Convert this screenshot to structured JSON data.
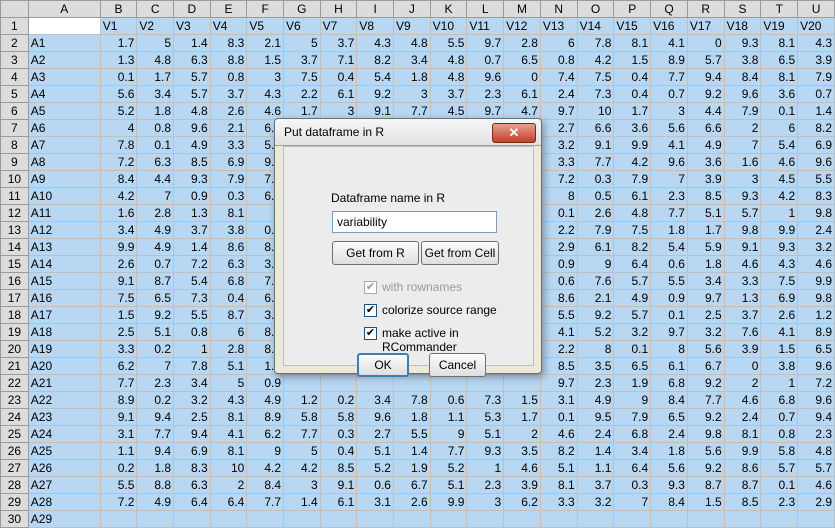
{
  "spreadsheet": {
    "columns": [
      "A",
      "B",
      "C",
      "D",
      "E",
      "F",
      "G",
      "H",
      "I",
      "J",
      "K",
      "L",
      "M",
      "N",
      "O",
      "P",
      "Q",
      "R",
      "S",
      "T",
      "U"
    ],
    "header_row": [
      "",
      "V1",
      "V2",
      "V3",
      "V4",
      "V5",
      "V6",
      "V7",
      "V8",
      "V9",
      "V10",
      "V11",
      "V12",
      "V13",
      "V14",
      "V15",
      "V16",
      "V17",
      "V18",
      "V19",
      "V20"
    ],
    "rows": [
      {
        "n": "2",
        "c": [
          "A1",
          "1.7",
          "5",
          "1.4",
          "8.3",
          "2.1",
          "5",
          "3.7",
          "4.3",
          "4.8",
          "5.5",
          "9.7",
          "2.8",
          "6",
          "7.8",
          "8.1",
          "4.1",
          "0",
          "9.3",
          "8.1",
          "4.3"
        ]
      },
      {
        "n": "3",
        "c": [
          "A2",
          "1.3",
          "4.8",
          "6.3",
          "8.8",
          "1.5",
          "3.7",
          "7.1",
          "8.2",
          "3.4",
          "4.8",
          "0.7",
          "6.5",
          "0.8",
          "4.2",
          "1.5",
          "8.9",
          "5.7",
          "3.8",
          "6.5",
          "3.9"
        ]
      },
      {
        "n": "4",
        "c": [
          "A3",
          "0.1",
          "1.7",
          "5.7",
          "0.8",
          "3",
          "7.5",
          "0.4",
          "5.4",
          "1.8",
          "4.8",
          "9.6",
          "0",
          "7.4",
          "7.5",
          "0.4",
          "7.7",
          "9.4",
          "8.4",
          "8.1",
          "7.9"
        ]
      },
      {
        "n": "5",
        "c": [
          "A4",
          "5.6",
          "3.4",
          "5.7",
          "3.7",
          "4.3",
          "2.2",
          "6.1",
          "9.2",
          "3",
          "3.7",
          "2.3",
          "6.1",
          "2.4",
          "7.3",
          "0.4",
          "0.7",
          "9.2",
          "9.6",
          "3.6",
          "0.7"
        ]
      },
      {
        "n": "6",
        "c": [
          "A5",
          "5.2",
          "1.8",
          "4.8",
          "2.6",
          "4.6",
          "1.7",
          "3",
          "9.1",
          "7.7",
          "4.5",
          "9.7",
          "4.7",
          "9.7",
          "10",
          "1.7",
          "3",
          "4.4",
          "7.9",
          "0.1",
          "1.4"
        ]
      },
      {
        "n": "7",
        "c": [
          "A6",
          "4",
          "0.8",
          "9.6",
          "2.1",
          "6.7",
          "",
          "",
          "",
          "",
          "",
          "",
          "",
          "2.7",
          "6.6",
          "3.6",
          "5.6",
          "6.6",
          "2",
          "6",
          "8.2"
        ]
      },
      {
        "n": "8",
        "c": [
          "A7",
          "7.8",
          "0.1",
          "4.9",
          "3.3",
          "5.9",
          "",
          "",
          "",
          "",
          "",
          "",
          "",
          "3.2",
          "9.1",
          "9.9",
          "4.1",
          "4.9",
          "7",
          "5.4",
          "6.9"
        ]
      },
      {
        "n": "9",
        "c": [
          "A8",
          "7.2",
          "6.3",
          "8.5",
          "6.9",
          "9.5",
          "",
          "",
          "",
          "",
          "",
          "",
          "",
          "3.3",
          "7.7",
          "4.2",
          "9.6",
          "3.6",
          "1.6",
          "4.6",
          "9.6"
        ]
      },
      {
        "n": "10",
        "c": [
          "A9",
          "8.4",
          "4.4",
          "9.3",
          "7.9",
          "7.8",
          "",
          "",
          "",
          "",
          "",
          "",
          "",
          "7.2",
          "0.3",
          "7.9",
          "7",
          "3.9",
          "3",
          "4.5",
          "5.5"
        ]
      },
      {
        "n": "11",
        "c": [
          "A10",
          "4.2",
          "7",
          "0.9",
          "0.3",
          "6.7",
          "",
          "",
          "",
          "",
          "",
          "",
          "",
          "8",
          "0.5",
          "6.1",
          "2.3",
          "8.5",
          "9.3",
          "4.2",
          "8.3"
        ]
      },
      {
        "n": "12",
        "c": [
          "A11",
          "1.6",
          "2.8",
          "1.3",
          "8.1",
          "5",
          "",
          "",
          "",
          "",
          "",
          "",
          "",
          "0.1",
          "2.6",
          "4.8",
          "7.7",
          "5.1",
          "5.7",
          "1",
          "9.8"
        ]
      },
      {
        "n": "13",
        "c": [
          "A12",
          "3.4",
          "4.9",
          "3.7",
          "3.8",
          "0.2",
          "",
          "",
          "",
          "",
          "",
          "",
          "",
          "2.2",
          "7.9",
          "7.5",
          "1.8",
          "1.7",
          "9.8",
          "9.9",
          "2.4"
        ]
      },
      {
        "n": "14",
        "c": [
          "A13",
          "9.9",
          "4.9",
          "1.4",
          "8.6",
          "8.3",
          "",
          "",
          "",
          "",
          "",
          "",
          "",
          "2.9",
          "6.1",
          "8.2",
          "5.4",
          "5.9",
          "9.1",
          "9.3",
          "3.2"
        ]
      },
      {
        "n": "15",
        "c": [
          "A14",
          "2.6",
          "0.7",
          "7.2",
          "6.3",
          "3.8",
          "",
          "",
          "",
          "",
          "",
          "",
          "",
          "0.9",
          "9",
          "6.4",
          "0.6",
          "1.8",
          "4.6",
          "4.3",
          "4.6"
        ]
      },
      {
        "n": "16",
        "c": [
          "A15",
          "9.1",
          "8.7",
          "5.4",
          "6.8",
          "7.6",
          "",
          "",
          "",
          "",
          "",
          "",
          "",
          "0.6",
          "7.6",
          "5.7",
          "5.5",
          "3.4",
          "3.3",
          "7.5",
          "9.9"
        ]
      },
      {
        "n": "17",
        "c": [
          "A16",
          "7.5",
          "6.5",
          "7.3",
          "0.4",
          "6.8",
          "",
          "",
          "",
          "",
          "",
          "",
          "",
          "8.6",
          "2.1",
          "4.9",
          "0.9",
          "9.7",
          "1.3",
          "6.9",
          "9.8"
        ]
      },
      {
        "n": "18",
        "c": [
          "A17",
          "1.5",
          "9.2",
          "5.5",
          "8.7",
          "3.3",
          "",
          "",
          "",
          "",
          "",
          "",
          "",
          "5.5",
          "9.2",
          "5.7",
          "0.1",
          "2.5",
          "3.7",
          "2.6",
          "1.2"
        ]
      },
      {
        "n": "19",
        "c": [
          "A18",
          "2.5",
          "5.1",
          "0.8",
          "6",
          "8.6",
          "",
          "",
          "",
          "",
          "",
          "",
          "",
          "4.1",
          "5.2",
          "3.2",
          "9.7",
          "3.2",
          "7.6",
          "4.1",
          "8.9"
        ]
      },
      {
        "n": "20",
        "c": [
          "A19",
          "3.3",
          "0.2",
          "1",
          "2.8",
          "8.6",
          "",
          "",
          "",
          "",
          "",
          "",
          "",
          "2.2",
          "8",
          "0.1",
          "8",
          "5.6",
          "3.9",
          "1.5",
          "6.5"
        ]
      },
      {
        "n": "21",
        "c": [
          "A20",
          "6.2",
          "7",
          "7.8",
          "5.1",
          "1.1",
          "",
          "",
          "",
          "",
          "",
          "",
          "",
          "8.5",
          "3.5",
          "6.5",
          "6.1",
          "6.7",
          "0",
          "3.8",
          "9.6"
        ]
      },
      {
        "n": "22",
        "c": [
          "A21",
          "7.7",
          "2.3",
          "3.4",
          "5",
          "0.9",
          "",
          "",
          "",
          "",
          "",
          "",
          "",
          "9.7",
          "2.3",
          "1.9",
          "6.8",
          "9.2",
          "2",
          "1",
          "7.2"
        ]
      },
      {
        "n": "23",
        "c": [
          "A22",
          "8.9",
          "0.2",
          "3.2",
          "4.3",
          "4.9",
          "1.2",
          "0.2",
          "3.4",
          "7.8",
          "0.6",
          "7.3",
          "1.5",
          "3.1",
          "4.9",
          "9",
          "8.4",
          "7.7",
          "4.6",
          "6.8",
          "9.6"
        ]
      },
      {
        "n": "24",
        "c": [
          "A23",
          "9.1",
          "9.4",
          "2.5",
          "8.1",
          "8.9",
          "5.8",
          "5.8",
          "9.6",
          "1.8",
          "1.1",
          "5.3",
          "1.7",
          "0.1",
          "9.5",
          "7.9",
          "6.5",
          "9.2",
          "2.4",
          "0.7",
          "9.4"
        ]
      },
      {
        "n": "25",
        "c": [
          "A24",
          "3.1",
          "7.7",
          "9.4",
          "4.1",
          "6.2",
          "7.7",
          "0.3",
          "2.7",
          "5.5",
          "9",
          "5.1",
          "2",
          "4.6",
          "2.4",
          "6.8",
          "2.4",
          "9.8",
          "8.1",
          "0.8",
          "2.3"
        ]
      },
      {
        "n": "26",
        "c": [
          "A25",
          "1.1",
          "9.4",
          "6.9",
          "8.1",
          "9",
          "5",
          "0.4",
          "5.1",
          "1.4",
          "7.7",
          "9.3",
          "3.5",
          "8.2",
          "1.4",
          "3.4",
          "1.8",
          "5.6",
          "9.9",
          "5.8",
          "4.8"
        ]
      },
      {
        "n": "27",
        "c": [
          "A26",
          "0.2",
          "1.8",
          "8.3",
          "10",
          "4.2",
          "4.2",
          "8.5",
          "5.2",
          "1.9",
          "5.2",
          "1",
          "4.6",
          "5.1",
          "1.1",
          "6.4",
          "5.6",
          "9.2",
          "8.6",
          "5.7",
          "5.7"
        ]
      },
      {
        "n": "28",
        "c": [
          "A27",
          "5.5",
          "8.8",
          "6.3",
          "2",
          "8.4",
          "3",
          "9.1",
          "0.6",
          "6.7",
          "5.1",
          "2.3",
          "3.9",
          "8.1",
          "3.7",
          "0.3",
          "9.3",
          "8.7",
          "8.7",
          "0.1",
          "4.6"
        ]
      },
      {
        "n": "29",
        "c": [
          "A28",
          "7.2",
          "4.9",
          "6.4",
          "6.4",
          "7.7",
          "1.4",
          "6.1",
          "3.1",
          "2.6",
          "9.9",
          "3",
          "6.2",
          "3.3",
          "3.2",
          "7",
          "8.4",
          "1.5",
          "8.5",
          "2.3",
          "2.9"
        ]
      },
      {
        "n": "30",
        "c": [
          "A29",
          "",
          "",
          "",
          "",
          "",
          "",
          "",
          "",
          "",
          "",
          "",
          "",
          "",
          "",
          "",
          "",
          "",
          "",
          "",
          ""
        ]
      }
    ]
  },
  "dialog": {
    "title": "Put dataframe in R",
    "close_symbol": "✕",
    "name_label": "Dataframe name in R",
    "name_value": "variability",
    "get_from_r": "Get from R",
    "get_from_cell": "Get from Cell",
    "with_rownames": "with rownames",
    "colorize": "colorize source range",
    "make_active": "make active in RCommander",
    "ok": "OK",
    "cancel": "Cancel",
    "check_mark": "✔"
  },
  "colors": {
    "selection": "#b7d7f2",
    "header": "#dcdcdc",
    "close_button": "#c2412b"
  }
}
